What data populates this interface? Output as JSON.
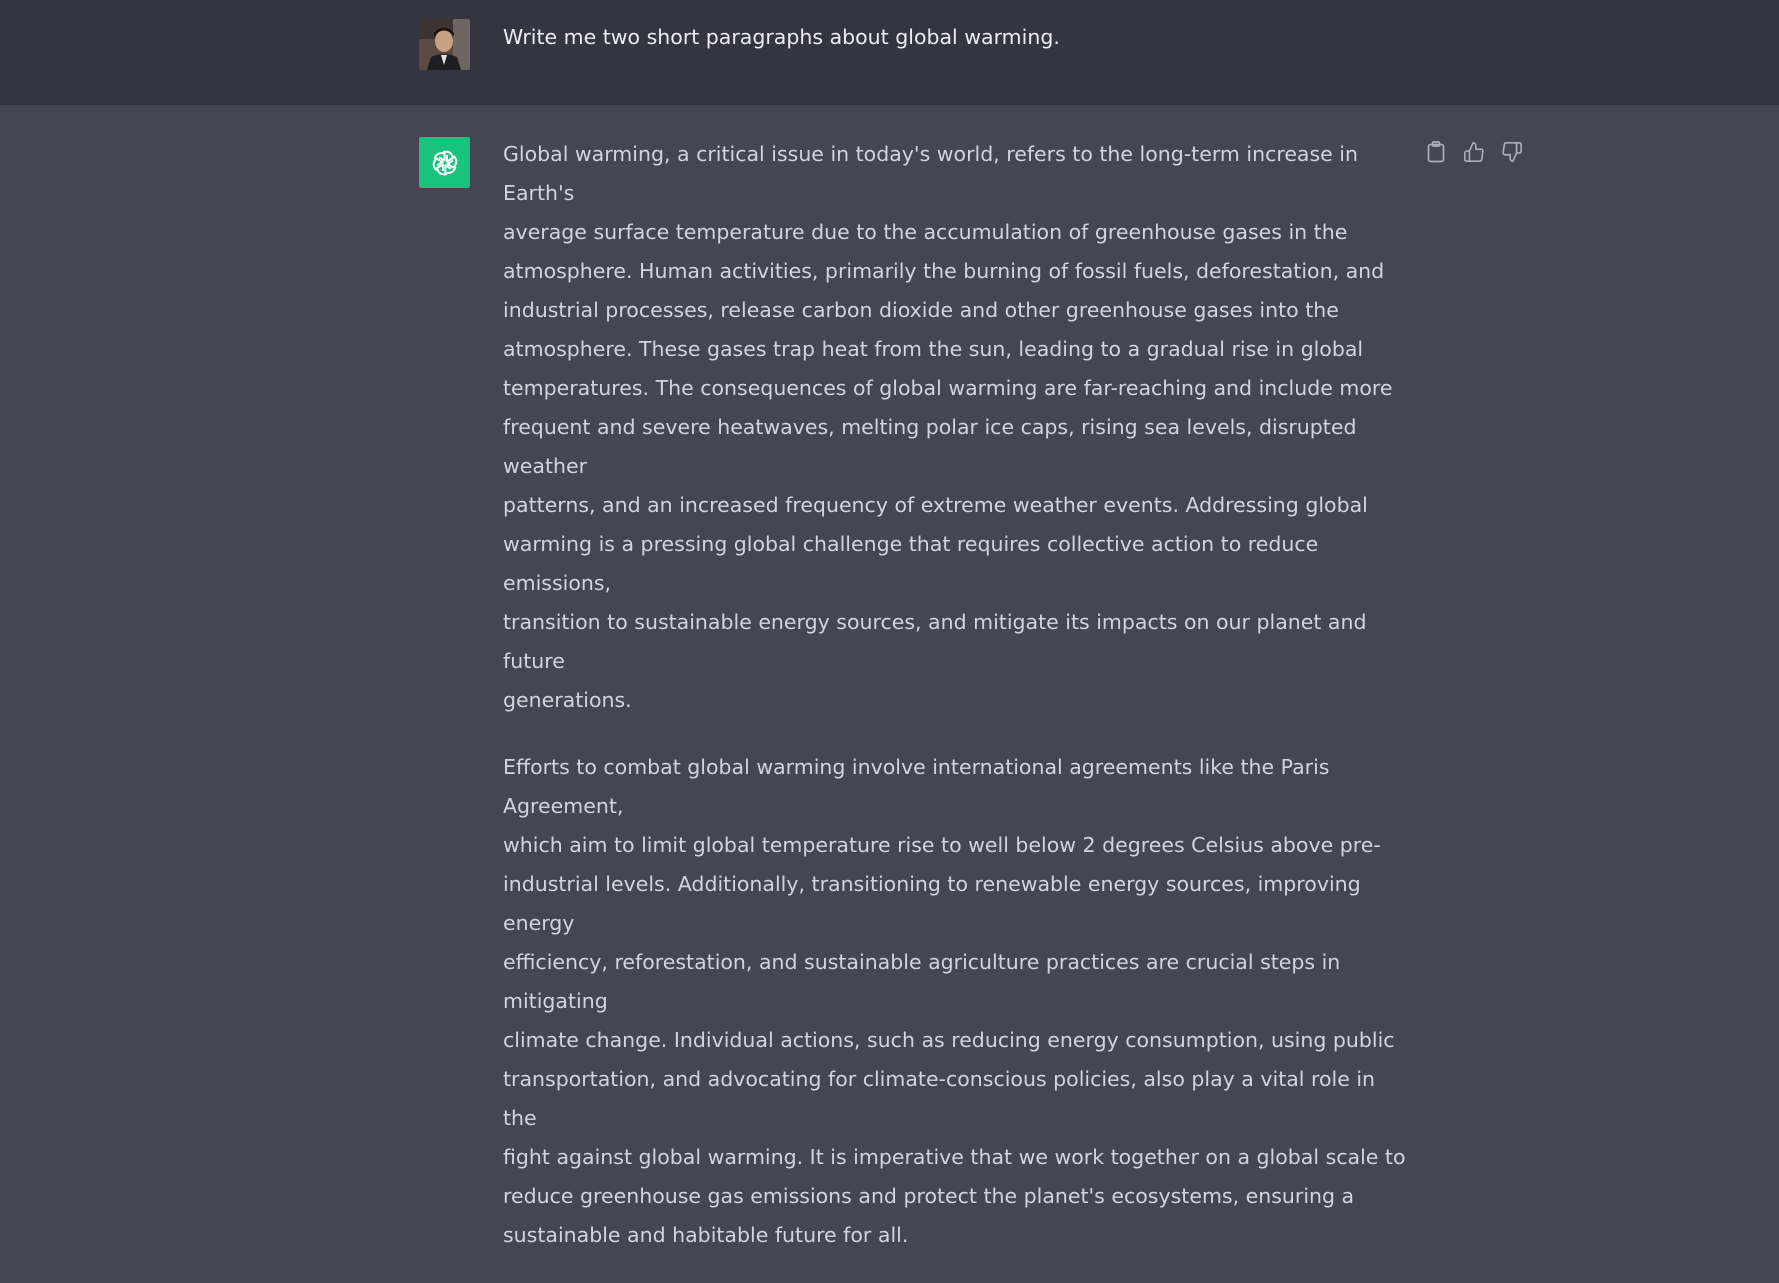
{
  "user_message": {
    "text": "Write me two short paragraphs about global warming.",
    "avatar_icon": "user-photo-avatar"
  },
  "assistant_message": {
    "avatar_icon": "openai-logo-icon",
    "avatar_color": "#19c37d",
    "paragraphs": [
      "Global warming, a critical issue in today's world, refers to the long-term increase in Earth's\naverage surface temperature due to the accumulation of greenhouse gases in the\natmosphere. Human activities, primarily the burning of fossil fuels, deforestation, and\nindustrial processes, release carbon dioxide and other greenhouse gases into the\natmosphere. These gases trap heat from the sun, leading to a gradual rise in global\ntemperatures. The consequences of global warming are far-reaching and include more\nfrequent and severe heatwaves, melting polar ice caps, rising sea levels, disrupted weather\npatterns, and an increased frequency of extreme weather events. Addressing global\nwarming is a pressing global challenge that requires collective action to reduce emissions,\ntransition to sustainable energy sources, and mitigate its impacts on our planet and future\ngenerations.",
      "Efforts to combat global warming involve international agreements like the Paris Agreement,\nwhich aim to limit global temperature rise to well below 2 degrees Celsius above pre-\nindustrial levels. Additionally, transitioning to renewable energy sources, improving energy\nefficiency, reforestation, and sustainable agriculture practices are crucial steps in mitigating\nclimate change. Individual actions, such as reducing energy consumption, using public\ntransportation, and advocating for climate-conscious policies, also play a vital role in the\nfight against global warming. It is imperative that we work together on a global scale to\nreduce greenhouse gas emissions and protect the planet's ecosystems, ensuring a\nsustainable and habitable future for all."
    ],
    "actions": [
      {
        "name": "copy-button",
        "icon": "clipboard-icon"
      },
      {
        "name": "thumbs-up-button",
        "icon": "thumbs-up-icon"
      },
      {
        "name": "thumbs-down-button",
        "icon": "thumbs-down-icon"
      }
    ]
  },
  "colors": {
    "user_row_bg": "#343541",
    "assistant_row_bg": "#444654",
    "user_text": "#ececf1",
    "assistant_text": "#d1d5db",
    "icon_color": "#acacbe"
  }
}
